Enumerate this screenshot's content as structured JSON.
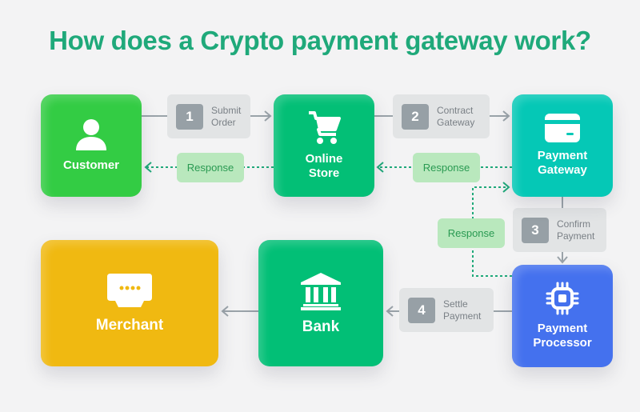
{
  "title": "How does a Crypto payment gateway work?",
  "colors": {
    "title": "#1fa97a",
    "customer": "#33cc44",
    "online_store": "#03bf76",
    "payment_gateway": "#05c8b6",
    "payment_processor": "#4471ee",
    "bank": "#02bf76",
    "merchant": "#f0b911",
    "response_fill": "#b9e8bd",
    "response_line": "#1fa97a",
    "step_fill": "#e2e4e5",
    "step_number": "#97a0a6"
  },
  "nodes": {
    "customer": {
      "label": "Customer",
      "icon": "user-icon"
    },
    "online_store": {
      "label": "Online Store",
      "icon": "shopping-cart-icon"
    },
    "payment_gateway": {
      "label": "Payment Gateway",
      "icon": "credit-card-icon"
    },
    "payment_processor": {
      "label": "Payment Processor",
      "icon": "chip-icon"
    },
    "bank": {
      "label": "Bank",
      "icon": "bank-icon"
    },
    "merchant": {
      "label": "Merchant",
      "icon": "pos-terminal-icon"
    }
  },
  "steps": [
    {
      "number": "1",
      "line1": "Submit",
      "line2": "Order",
      "from": "Customer",
      "to": "Online Store"
    },
    {
      "number": "2",
      "line1": "Contract",
      "line2": "Gateway",
      "from": "Online Store",
      "to": "Payment Gateway"
    },
    {
      "number": "3",
      "line1": "Confirm",
      "line2": "Payment",
      "from": "Payment Gateway",
      "to": "Payment Processor"
    },
    {
      "number": "4",
      "line1": "Settle",
      "line2": "Payment",
      "from": "Payment Processor",
      "to": "Bank"
    }
  ],
  "responses": [
    {
      "label": "Response",
      "from": "Online Store",
      "to": "Customer"
    },
    {
      "label": "Response",
      "from": "Payment Gateway",
      "to": "Online Store"
    },
    {
      "label": "Response",
      "from": "Payment Processor",
      "to": "Payment Gateway"
    }
  ],
  "final_flow": {
    "from": "Bank",
    "to": "Merchant"
  }
}
